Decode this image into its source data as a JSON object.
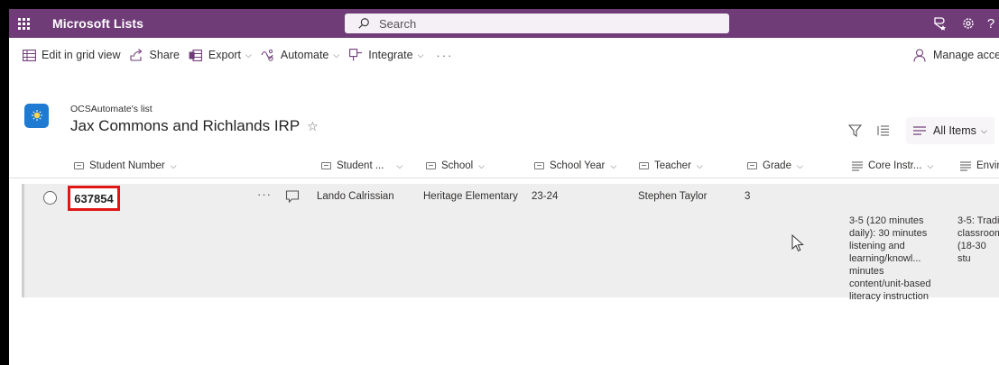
{
  "suitebar": {
    "app_name": "Microsoft Lists",
    "search_placeholder": "Search",
    "icons": [
      "waffle-icon",
      "search-icon",
      "rewards-icon",
      "gear-icon",
      "help-icon"
    ],
    "help_label": "?"
  },
  "commandbar": {
    "edit_grid": "Edit in grid view",
    "share": "Share",
    "export": "Export",
    "automate": "Automate",
    "integrate": "Integrate",
    "more": "···",
    "manage_access": "Manage acces"
  },
  "list": {
    "owner": "OCSAutomate's list",
    "title": "Jax Commons and Richlands IRP",
    "view_name": "All Items"
  },
  "columns": {
    "student_number": "Student Number",
    "student": "Student ...",
    "school": "School",
    "school_year": "School Year",
    "teacher": "Teacher",
    "grade": "Grade",
    "core_instr": "Core Instr...",
    "envir": "Envir"
  },
  "row": {
    "student_number": "637854",
    "more": "···",
    "student": "Lando Calrissian",
    "school": "Heritage Elementary",
    "school_year": "23-24",
    "teacher": "Stephen Taylor",
    "grade": "3",
    "core_instr": "3-5 (120 minutes daily): 30 minutes listening and learning/knowl... minutes content/unit-based literacy instruction",
    "envir": "3-5: Tradi classroom (18-30 stu"
  },
  "colors": {
    "suitebar": "#6f3c78",
    "highlight": "#e01616",
    "list_logo": "#1f7bd1"
  }
}
